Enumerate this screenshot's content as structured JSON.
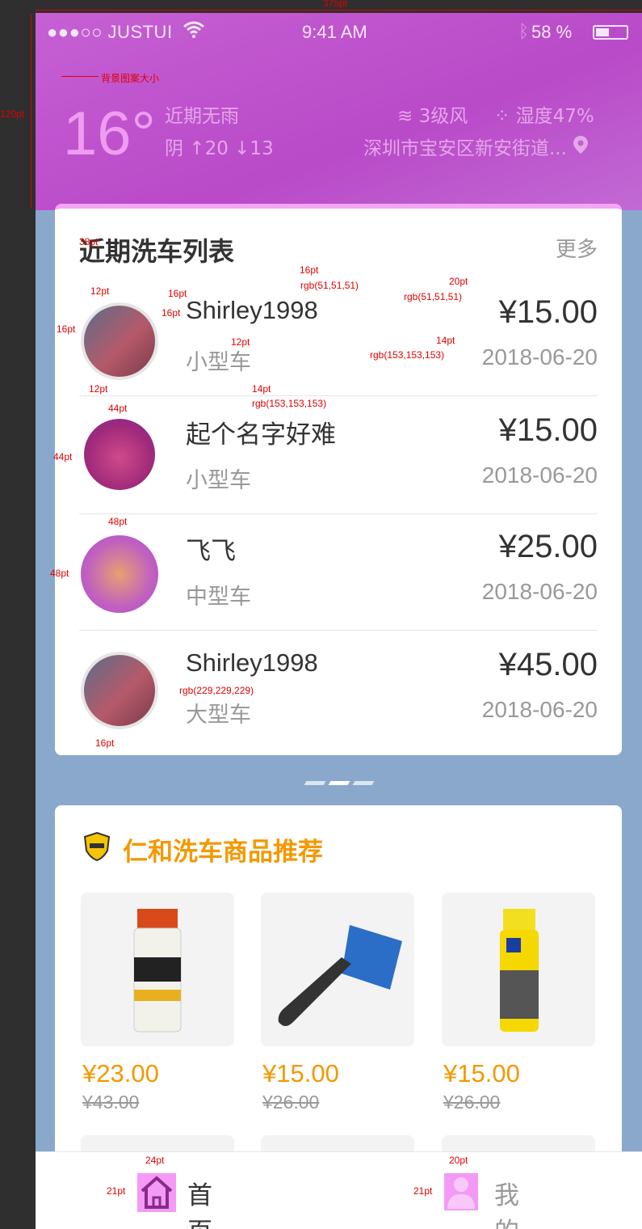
{
  "spec": {
    "width_label": "375pt",
    "height_label": "120pt",
    "bg_label": "背景图案大小",
    "labels": [
      "38pt",
      "12pt",
      "16pt",
      "16pt",
      "16pt",
      "rgb(51,51,51)",
      "rgb(51,51,51)",
      "20pt",
      "16pt",
      "12pt",
      "14pt",
      "rgb(153,153,153)",
      "14pt",
      "rgb(153,153,153)",
      "12pt",
      "44pt",
      "44pt",
      "48pt",
      "48pt",
      "rgb(229,229,229)",
      "16pt",
      "24pt",
      "21pt",
      "20pt",
      "21pt"
    ]
  },
  "status_bar": {
    "carrier": "●●●○○ JUSTUI",
    "time": "9:41 AM",
    "battery": "58 %"
  },
  "weather": {
    "temperature": "16°",
    "rain": "近期无雨",
    "condition": "阴  ↑20  ↓13",
    "wind": "3级风",
    "humidity": "湿度47%",
    "location": "深圳市宝安区新安街道..."
  },
  "wash_list": {
    "title": "近期洗车列表",
    "more": "更多",
    "items": [
      {
        "name": "Shirley1998",
        "type": "小型车",
        "price": "¥15.00",
        "date": "2018-06-20"
      },
      {
        "name": "起个名字好难",
        "type": "小型车",
        "price": "¥15.00",
        "date": "2018-06-20"
      },
      {
        "name": "飞飞",
        "type": "中型车",
        "price": "¥25.00",
        "date": "2018-06-20"
      },
      {
        "name": "Shirley1998",
        "type": "大型车",
        "price": "¥45.00",
        "date": "2018-06-20"
      }
    ]
  },
  "products": {
    "title": "仁和洗车商品推荐",
    "items": [
      {
        "price": "¥23.00",
        "original": "¥43.00"
      },
      {
        "price": "¥15.00",
        "original": "¥26.00"
      },
      {
        "price": "¥15.00",
        "original": "¥26.00"
      }
    ]
  },
  "tabbar": {
    "home": "首页",
    "mine": "我的"
  },
  "colors": {
    "header": "#c060d0",
    "accent": "#f39800",
    "text_dark": "#333333",
    "text_gray": "#999999",
    "divider": "#e5e5e5"
  }
}
